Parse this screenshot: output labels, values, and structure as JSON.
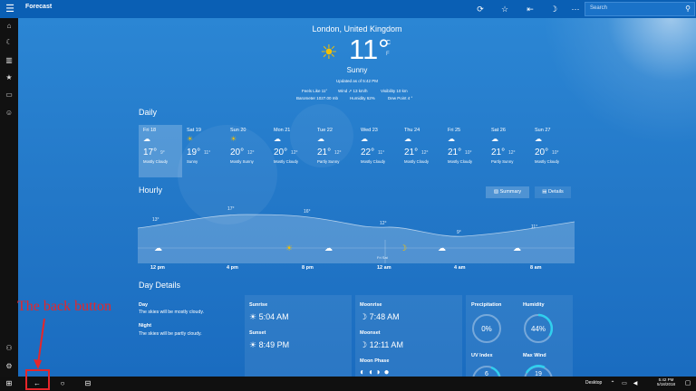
{
  "titlebar": {
    "app_title": "Forecast",
    "search_placeholder": "Search",
    "icons": [
      "menu-icon",
      "refresh-icon",
      "favorite-icon",
      "pin-icon",
      "night-mode-icon",
      "more-icon",
      "search-icon"
    ]
  },
  "sidebar": {
    "icons": [
      "home-icon",
      "maps-icon",
      "historical-icon",
      "places-icon",
      "news-icon",
      "feedback-icon",
      "account-icon",
      "settings-icon"
    ]
  },
  "current": {
    "location": "London, United Kingdom",
    "temp": "11°",
    "unit_c": "C",
    "unit_f": "F",
    "condition": "Sunny",
    "updated": "Updated as of 5:42 PM",
    "feels_like": "Feels Like  11°",
    "wind": "Wind  ➚ 13 km/h",
    "visibility": "Visibility  10 km",
    "barometer": "Barometer  1027.00 mb",
    "humidity": "Humidity  62%",
    "dew_point": "Dew Point  4 °"
  },
  "daily": {
    "title": "Daily",
    "days": [
      {
        "name": "Fri 18",
        "hi": "17°",
        "lo": "9°",
        "cond": "Mostly Cloudy",
        "icon": "☁"
      },
      {
        "name": "Sat 19",
        "hi": "19°",
        "lo": "11°",
        "cond": "Sunny",
        "icon": "☀"
      },
      {
        "name": "Sun 20",
        "hi": "20°",
        "lo": "12°",
        "cond": "Mostly Sunny",
        "icon": "☀"
      },
      {
        "name": "Mon 21",
        "hi": "20°",
        "lo": "12°",
        "cond": "Mostly Cloudy",
        "icon": "☁"
      },
      {
        "name": "Tue 22",
        "hi": "21°",
        "lo": "12°",
        "cond": "Partly Sunny",
        "icon": "☁"
      },
      {
        "name": "Wed 23",
        "hi": "22°",
        "lo": "11°",
        "cond": "Mostly Cloudy",
        "icon": "☁"
      },
      {
        "name": "Thu 24",
        "hi": "21°",
        "lo": "12°",
        "cond": "Mostly Cloudy",
        "icon": "☁"
      },
      {
        "name": "Fri 25",
        "hi": "21°",
        "lo": "10°",
        "cond": "Mostly Cloudy",
        "icon": "☁"
      },
      {
        "name": "Sat 26",
        "hi": "21°",
        "lo": "12°",
        "cond": "Partly Sunny",
        "icon": "☁"
      },
      {
        "name": "Sun 27",
        "hi": "20°",
        "lo": "10°",
        "cond": "Mostly Cloudy",
        "icon": "☁"
      }
    ]
  },
  "hourly": {
    "title": "Hourly",
    "summary_label": "Summary",
    "details_label": "Details",
    "temps": [
      "13°",
      "17°",
      "16°",
      "12°",
      "9°",
      "11°"
    ],
    "time_labels": [
      "12 pm",
      "4 pm",
      "8 pm",
      "12 am",
      "4 am",
      "8 am"
    ],
    "day_split": "Fri  Sat"
  },
  "details": {
    "title": "Day Details",
    "day_label": "Day",
    "day_text": "The skies will be mostly cloudy.",
    "night_label": "Night",
    "night_text": "The skies will be partly cloudy.",
    "sunrise_label": "Sunrise",
    "sunrise": "5:04 AM",
    "sunset_label": "Sunset",
    "sunset": "8:49 PM",
    "moonrise_label": "Moonrise",
    "moonrise": "7:48 AM",
    "moonset_label": "Moonset",
    "moonset": "12:11 AM",
    "moon_phase_label": "Moon Phase",
    "precip_label": "Precipitation",
    "precip": "0%",
    "precip_level": 0,
    "humidity_label": "Humidity",
    "humidity": "44%",
    "humidity_level": 0.44,
    "uv_label": "UV Index",
    "uv": "6",
    "wind_label": "Max Wind",
    "wind": "19"
  },
  "taskbar": {
    "desktop_label": "Desktop",
    "time": "5:42 PM",
    "date": "5/18/2018"
  },
  "annotation": {
    "text": "The back button"
  }
}
